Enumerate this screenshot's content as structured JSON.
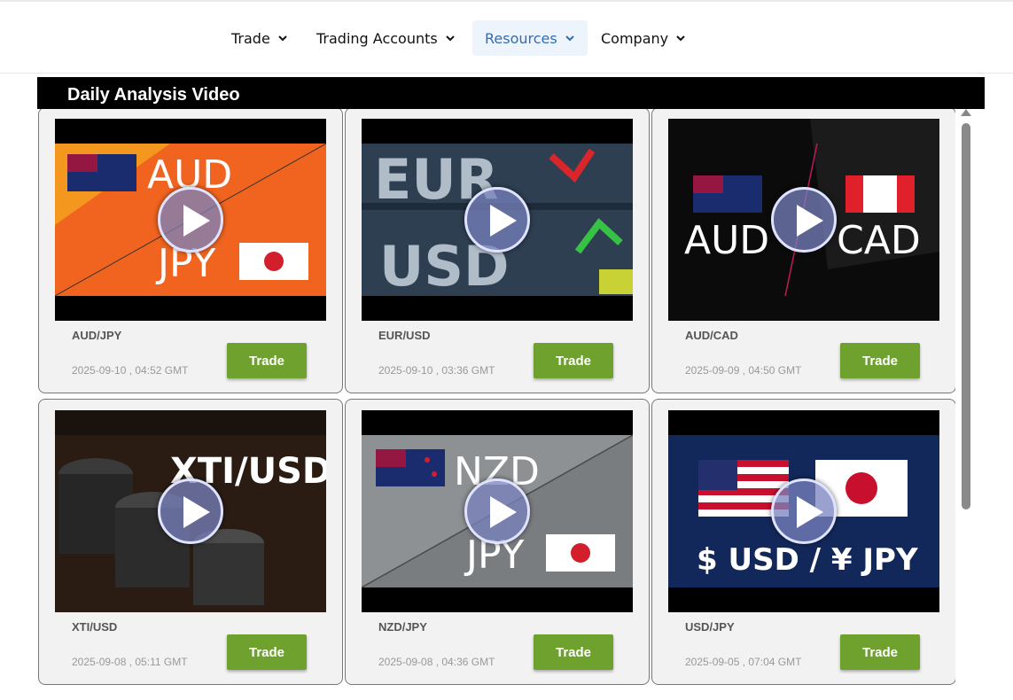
{
  "nav": {
    "items": [
      {
        "label": "Trade",
        "icon": "chevron-down-icon",
        "active": false
      },
      {
        "label": "Trading Accounts",
        "icon": "chevron-down-icon",
        "active": false
      },
      {
        "label": "Resources",
        "icon": "chevron-down-icon",
        "active": true
      },
      {
        "label": "Company",
        "icon": "chevron-down-icon",
        "active": false
      }
    ]
  },
  "panel": {
    "title": "Daily Analysis Video"
  },
  "videos": [
    {
      "pair": "AUD/JPY",
      "date": "2025-09-10 , 04:52 GMT",
      "button": "Trade",
      "thumb_line1": "AUD",
      "thumb_line2": "JPY"
    },
    {
      "pair": "EUR/USD",
      "date": "2025-09-10 , 03:36 GMT",
      "button": "Trade",
      "thumb_line1": "EUR",
      "thumb_line2": "USD"
    },
    {
      "pair": "AUD/CAD",
      "date": "2025-09-09 , 04:50 GMT",
      "button": "Trade",
      "thumb_line1": "AUD",
      "thumb_line2": "CAD"
    },
    {
      "pair": "XTI/USD",
      "date": "2025-09-08 , 05:11 GMT",
      "button": "Trade",
      "thumb_line1": "XTI/USD",
      "thumb_line2": ""
    },
    {
      "pair": "NZD/JPY",
      "date": "2025-09-08 , 04:36 GMT",
      "button": "Trade",
      "thumb_line1": "NZD",
      "thumb_line2": "JPY"
    },
    {
      "pair": "USD/JPY",
      "date": "2025-09-05 , 07:04 GMT",
      "button": "Trade",
      "thumb_line1": "$ USD / ¥ JPY",
      "thumb_line2": ""
    }
  ],
  "colors": {
    "trade_button": "#6ea12e",
    "nav_active_text": "#2f6db5",
    "nav_active_bg": "#eef4fb"
  }
}
